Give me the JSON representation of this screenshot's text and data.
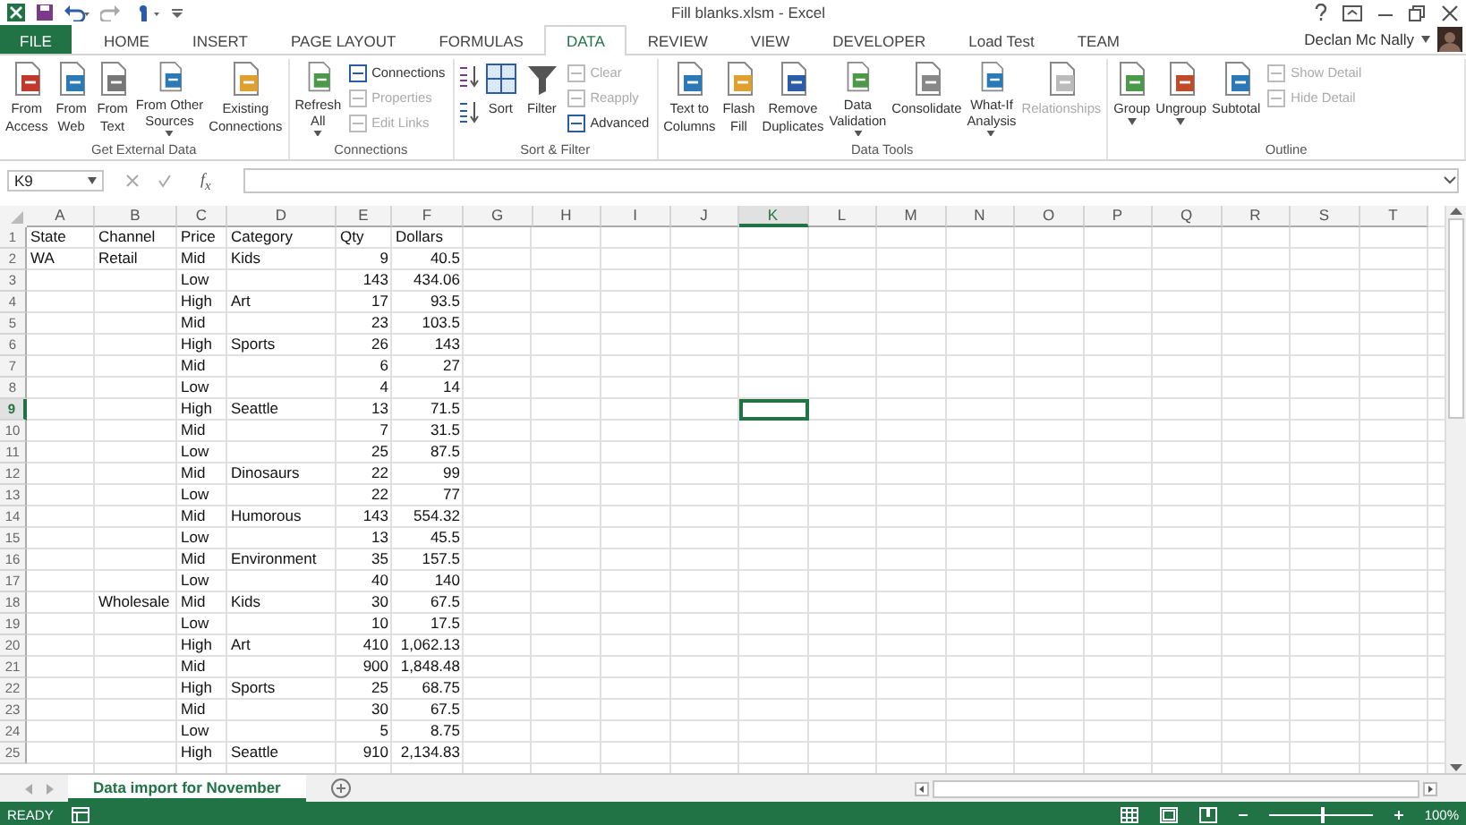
{
  "window": {
    "title": "Fill blanks.xlsm - Excel",
    "user": "Declan Mc Nally"
  },
  "tabs": [
    {
      "label": "FILE",
      "kind": "file",
      "selected": false
    },
    {
      "label": "HOME",
      "kind": "tab",
      "selected": false
    },
    {
      "label": "INSERT",
      "kind": "tab",
      "selected": false
    },
    {
      "label": "PAGE LAYOUT",
      "kind": "tab",
      "selected": false
    },
    {
      "label": "FORMULAS",
      "kind": "tab",
      "selected": false
    },
    {
      "label": "DATA",
      "kind": "tab",
      "selected": true
    },
    {
      "label": "REVIEW",
      "kind": "tab",
      "selected": false
    },
    {
      "label": "VIEW",
      "kind": "tab",
      "selected": false
    },
    {
      "label": "DEVELOPER",
      "kind": "tab",
      "selected": false
    },
    {
      "label": "Load Test",
      "kind": "tab",
      "selected": false
    },
    {
      "label": "TEAM",
      "kind": "tab",
      "selected": false
    }
  ],
  "ribbon": [
    {
      "label": "Get External Data",
      "items": [
        {
          "kind": "large",
          "lines": [
            "From",
            "Access"
          ],
          "disabled": false,
          "dropdown": false
        },
        {
          "kind": "large",
          "lines": [
            "From",
            "Web"
          ],
          "disabled": false,
          "dropdown": false
        },
        {
          "kind": "large",
          "lines": [
            "From",
            "Text"
          ],
          "disabled": false,
          "dropdown": false
        },
        {
          "kind": "large",
          "lines": [
            "From Other",
            "Sources"
          ],
          "disabled": false,
          "dropdown": true
        },
        {
          "kind": "large",
          "lines": [
            "Existing",
            "Connections"
          ],
          "disabled": false,
          "dropdown": false
        }
      ]
    },
    {
      "label": "Connections",
      "items": [
        {
          "kind": "large",
          "lines": [
            "Refresh",
            "All"
          ],
          "disabled": false,
          "dropdown": true
        },
        {
          "kind": "stack",
          "items": [
            {
              "label": "Connections",
              "disabled": false
            },
            {
              "label": "Properties",
              "disabled": true
            },
            {
              "label": "Edit Links",
              "disabled": true
            }
          ]
        }
      ]
    },
    {
      "label": "Sort & Filter",
      "items": [
        {
          "kind": "sortpair"
        },
        {
          "kind": "large",
          "lines": [
            "Sort"
          ],
          "disabled": false,
          "dropdown": false
        },
        {
          "kind": "large",
          "lines": [
            "Filter"
          ],
          "disabled": false,
          "dropdown": false
        },
        {
          "kind": "stack",
          "items": [
            {
              "label": "Clear",
              "disabled": true
            },
            {
              "label": "Reapply",
              "disabled": true
            },
            {
              "label": "Advanced",
              "disabled": false
            }
          ]
        }
      ]
    },
    {
      "label": "Data Tools",
      "items": [
        {
          "kind": "large",
          "lines": [
            "Text to",
            "Columns"
          ],
          "disabled": false,
          "dropdown": false
        },
        {
          "kind": "large",
          "lines": [
            "Flash",
            "Fill"
          ],
          "disabled": false,
          "dropdown": false
        },
        {
          "kind": "large",
          "lines": [
            "Remove",
            "Duplicates"
          ],
          "disabled": false,
          "dropdown": false
        },
        {
          "kind": "large",
          "lines": [
            "Data",
            "Validation"
          ],
          "disabled": false,
          "dropdown": true
        },
        {
          "kind": "large",
          "lines": [
            "Consolidate"
          ],
          "disabled": false,
          "dropdown": false
        },
        {
          "kind": "large",
          "lines": [
            "What-If",
            "Analysis"
          ],
          "disabled": false,
          "dropdown": true
        },
        {
          "kind": "large",
          "lines": [
            "Relationships"
          ],
          "disabled": true,
          "dropdown": false
        }
      ]
    },
    {
      "label": "Outline",
      "items": [
        {
          "kind": "large",
          "lines": [
            "Group"
          ],
          "disabled": false,
          "dropdown": true
        },
        {
          "kind": "large",
          "lines": [
            "Ungroup"
          ],
          "disabled": false,
          "dropdown": true
        },
        {
          "kind": "large",
          "lines": [
            "Subtotal"
          ],
          "disabled": false,
          "dropdown": false
        },
        {
          "kind": "stack",
          "items": [
            {
              "label": "Show Detail",
              "disabled": true
            },
            {
              "label": "Hide Detail",
              "disabled": true
            }
          ]
        }
      ]
    }
  ],
  "formula_bar": {
    "name_box": "K9",
    "function_label": "f$_{x}$"
  },
  "sheet": {
    "columns": [
      {
        "label": "A",
        "selected": false
      },
      {
        "label": "B",
        "selected": false
      },
      {
        "label": "C",
        "selected": false
      },
      {
        "label": "D",
        "selected": false
      },
      {
        "label": "E",
        "selected": false
      },
      {
        "label": "F",
        "selected": false
      },
      {
        "label": "G",
        "selected": false
      },
      {
        "label": "H",
        "selected": false
      },
      {
        "label": "I",
        "selected": false
      },
      {
        "label": "J",
        "selected": false
      },
      {
        "label": "K",
        "selected": true
      },
      {
        "label": "L",
        "selected": false
      },
      {
        "label": "M",
        "selected": false
      },
      {
        "label": "N",
        "selected": false
      },
      {
        "label": "O",
        "selected": false
      },
      {
        "label": "P",
        "selected": false
      },
      {
        "label": "Q",
        "selected": false
      },
      {
        "label": "R",
        "selected": false
      },
      {
        "label": "S",
        "selected": false
      },
      {
        "label": "T",
        "selected": false
      }
    ],
    "rows": [
      {
        "number": "1",
        "selected": false,
        "cells": [
          "State",
          "Channel",
          "Price",
          "Category",
          "Qty",
          "Dollars"
        ]
      },
      {
        "number": "2",
        "selected": false,
        "cells": [
          "WA",
          "Retail",
          "Mid",
          "Kids",
          "9",
          "40.5"
        ]
      },
      {
        "number": "3",
        "selected": false,
        "cells": [
          null,
          null,
          "Low",
          null,
          "143",
          "434.06"
        ]
      },
      {
        "number": "4",
        "selected": false,
        "cells": [
          null,
          null,
          "High",
          "Art",
          "17",
          "93.5"
        ]
      },
      {
        "number": "5",
        "selected": false,
        "cells": [
          null,
          null,
          "Mid",
          null,
          "23",
          "103.5"
        ]
      },
      {
        "number": "6",
        "selected": false,
        "cells": [
          null,
          null,
          "High",
          "Sports",
          "26",
          "143"
        ]
      },
      {
        "number": "7",
        "selected": false,
        "cells": [
          null,
          null,
          "Mid",
          null,
          "6",
          "27"
        ]
      },
      {
        "number": "8",
        "selected": false,
        "cells": [
          null,
          null,
          "Low",
          null,
          "4",
          "14"
        ]
      },
      {
        "number": "9",
        "selected": true,
        "cells": [
          null,
          null,
          "High",
          "Seattle",
          "13",
          "71.5"
        ]
      },
      {
        "number": "10",
        "selected": false,
        "cells": [
          null,
          null,
          "Mid",
          null,
          "7",
          "31.5"
        ]
      },
      {
        "number": "11",
        "selected": false,
        "cells": [
          null,
          null,
          "Low",
          null,
          "25",
          "87.5"
        ]
      },
      {
        "number": "12",
        "selected": false,
        "cells": [
          null,
          null,
          "Mid",
          "Dinosaurs",
          "22",
          "99"
        ]
      },
      {
        "number": "13",
        "selected": false,
        "cells": [
          null,
          null,
          "Low",
          null,
          "22",
          "77"
        ]
      },
      {
        "number": "14",
        "selected": false,
        "cells": [
          null,
          null,
          "Mid",
          "Humorous",
          "143",
          "554.32"
        ]
      },
      {
        "number": "15",
        "selected": false,
        "cells": [
          null,
          null,
          "Low",
          null,
          "13",
          "45.5"
        ]
      },
      {
        "number": "16",
        "selected": false,
        "cells": [
          null,
          null,
          "Mid",
          "Environment",
          "35",
          "157.5"
        ]
      },
      {
        "number": "17",
        "selected": false,
        "cells": [
          null,
          null,
          "Low",
          null,
          "40",
          "140"
        ]
      },
      {
        "number": "18",
        "selected": false,
        "cells": [
          null,
          "Wholesale",
          "Mid",
          "Kids",
          "30",
          "67.5"
        ]
      },
      {
        "number": "19",
        "selected": false,
        "cells": [
          null,
          null,
          "Low",
          null,
          "10",
          "17.5"
        ]
      },
      {
        "number": "20",
        "selected": false,
        "cells": [
          null,
          null,
          "High",
          "Art",
          "410",
          "1,062.13"
        ]
      },
      {
        "number": "21",
        "selected": false,
        "cells": [
          null,
          null,
          "Mid",
          null,
          "900",
          "1,848.48"
        ]
      },
      {
        "number": "22",
        "selected": false,
        "cells": [
          null,
          null,
          "High",
          "Sports",
          "25",
          "68.75"
        ]
      },
      {
        "number": "23",
        "selected": false,
        "cells": [
          null,
          null,
          "Mid",
          null,
          "30",
          "67.5"
        ]
      },
      {
        "number": "24",
        "selected": false,
        "cells": [
          null,
          null,
          "Low",
          null,
          "5",
          "8.75"
        ]
      },
      {
        "number": "25",
        "selected": false,
        "cells": [
          null,
          null,
          "High",
          "Seattle",
          "910",
          "2,134.83"
        ]
      }
    ]
  },
  "sheet_tabs": [
    {
      "label": "Data import for November",
      "selected": true
    }
  ],
  "status_bar": {
    "status": "READY",
    "zoom": {
      "level": 0.5,
      "reading": "100%"
    }
  }
}
